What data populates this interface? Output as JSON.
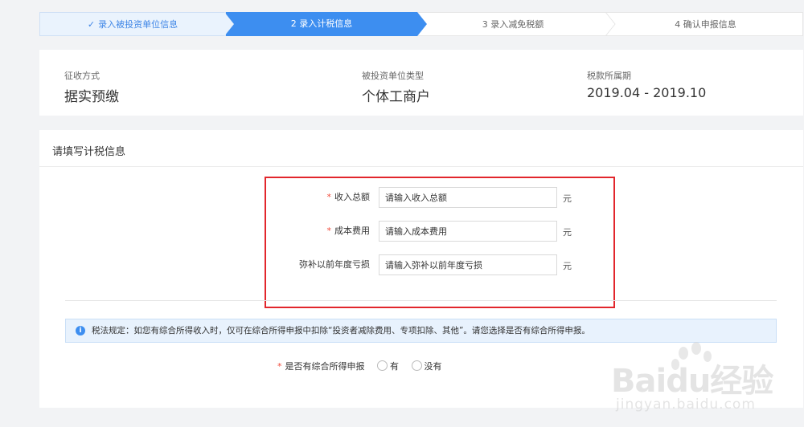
{
  "steps": [
    {
      "label": "录入被投资单位信息",
      "state": "done"
    },
    {
      "label": "2 录入计税信息",
      "state": "active"
    },
    {
      "label": "3 录入减免税额",
      "state": "todo"
    },
    {
      "label": "4 确认申报信息",
      "state": "todo"
    }
  ],
  "summary": {
    "collection_method_label": "征收方式",
    "collection_method_value": "据实预缴",
    "unit_type_label": "被投资单位类型",
    "unit_type_value": "个体工商户",
    "period_label": "税款所属期",
    "period_value": "2019.04 - 2019.10"
  },
  "form": {
    "title": "请填写计税信息",
    "fields": [
      {
        "label": "收入总额",
        "required": true,
        "placeholder": "请输入收入总额",
        "unit": "元"
      },
      {
        "label": "成本费用",
        "required": true,
        "placeholder": "请输入成本费用",
        "unit": "元"
      },
      {
        "label": "弥补以前年度亏损",
        "required": false,
        "placeholder": "请输入弥补以前年度亏损",
        "unit": "元"
      }
    ],
    "required_mark": "*",
    "notice": "税法规定：如您有综合所得收入时，仅可在综合所得申报中扣除“投资者减除费用、专项扣除、其他”。请您选择是否有综合所得申报。",
    "notice_icon": "info-icon",
    "radio_question": "是否有综合所得申报",
    "radio_options": [
      "有",
      "没有"
    ]
  },
  "watermark": {
    "brand": "Baidu经验",
    "url": "jingyan.baidu.com"
  },
  "colors": {
    "primary": "#3d8ef0",
    "step_done_bg": "#eaf3fd",
    "required": "#f04a3a",
    "highlight_box": "#e2262c",
    "notice_bg": "#e8f2fd"
  }
}
